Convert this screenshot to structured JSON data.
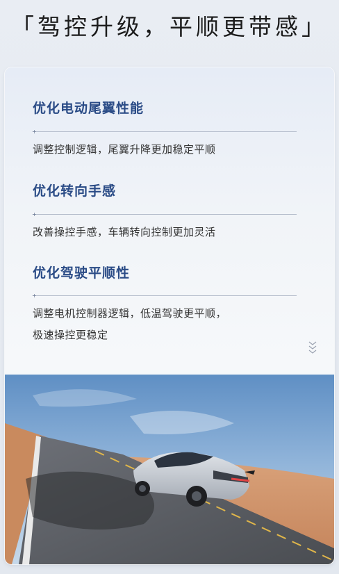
{
  "header": {
    "title": "「驾控升级，平顺更带感」"
  },
  "features": [
    {
      "title": "优化电动尾翼性能",
      "desc_lines": [
        "调整控制逻辑，尾翼升降更加稳定平顺"
      ]
    },
    {
      "title": "优化转向手感",
      "desc_lines": [
        "改善操控手感，车辆转向控制更加灵活"
      ]
    },
    {
      "title": "优化驾驶平顺性",
      "desc_lines": [
        "调整电机控制器逻辑，低温驾驶更平顺，",
        "极速操控更稳定"
      ]
    }
  ],
  "icons": {
    "scroll_hint": "chevrons-down-icon"
  },
  "image": {
    "subject": "silver SUV coupe on desert road"
  }
}
